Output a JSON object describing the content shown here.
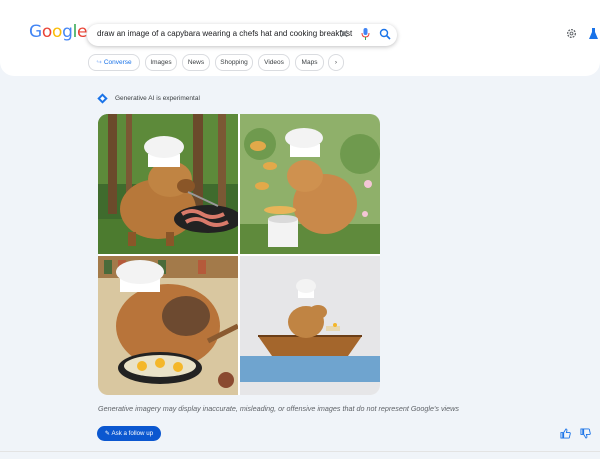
{
  "header": {
    "logo_letters": [
      {
        "ch": "G",
        "color": "#4285f4"
      },
      {
        "ch": "o",
        "color": "#ea4335"
      },
      {
        "ch": "o",
        "color": "#fbbc05"
      },
      {
        "ch": "g",
        "color": "#4285f4"
      },
      {
        "ch": "l",
        "color": "#34a853"
      },
      {
        "ch": "e",
        "color": "#ea4335"
      }
    ],
    "search": {
      "query": "draw an image of a capybara wearing a chefs hat and cooking breakfast",
      "clear_icon": "close-icon",
      "mic_icon": "mic-icon",
      "search_icon": "search-icon"
    },
    "settings_icon": "gear-icon",
    "labs_icon": "labs-flask-icon",
    "chips": [
      {
        "label": "Converse",
        "icon": "arrow-icon"
      },
      {
        "label": "Images"
      },
      {
        "label": "News"
      },
      {
        "label": "Shopping"
      },
      {
        "label": "Videos"
      },
      {
        "label": "Maps"
      }
    ],
    "chips_more_icon": "chevron-right-icon"
  },
  "sge": {
    "label": "Generative AI is experimental",
    "label_icon": "sparkle-diamond-icon",
    "images": [
      {
        "name": "capybara-grill"
      },
      {
        "name": "capybara-pancakes-garden"
      },
      {
        "name": "capybara-frying-eggs"
      },
      {
        "name": "capybara-boat"
      }
    ],
    "disclaimer": "Generative imagery may display inaccurate, misleading, or offensive images that do not represent Google's views",
    "followup_label": "Ask a follow up",
    "followup_icon": "pencil-icon",
    "thumbs_up_icon": "thumbs-up-icon",
    "thumbs_down_icon": "thumbs-down-icon"
  },
  "colors": {
    "accent": "#0b57d0",
    "background": "#f0f4f9"
  }
}
